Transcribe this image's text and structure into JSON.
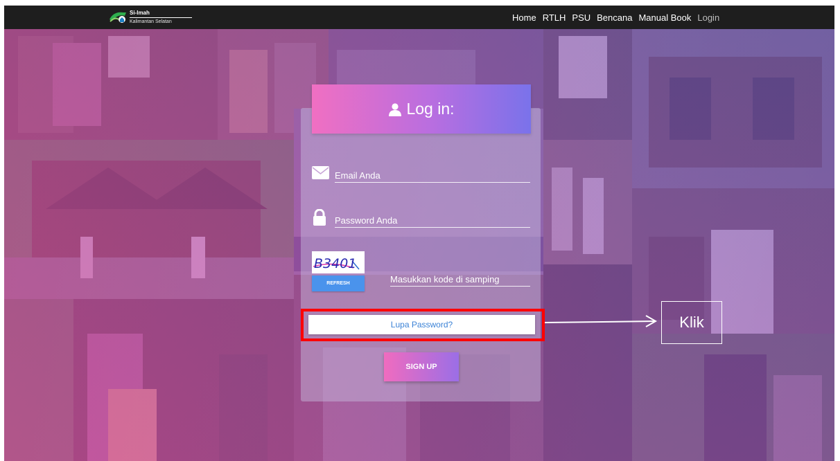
{
  "brand": {
    "name": "Si-Imah",
    "subtitle": "Kalimantan Selatan"
  },
  "nav": [
    {
      "label": "Home",
      "active": false
    },
    {
      "label": "RTLH",
      "active": false
    },
    {
      "label": "PSU",
      "active": false
    },
    {
      "label": "Bencana",
      "active": false
    },
    {
      "label": "Manual Book",
      "active": false
    },
    {
      "label": "Login",
      "active": true
    }
  ],
  "login": {
    "title": "Log in:",
    "email_placeholder": "Email Anda",
    "password_placeholder": "Password Anda",
    "captcha_text": "B3401",
    "refresh_label": "REFRESH",
    "captcha_placeholder": "Masukkan kode di samping",
    "forgot_label": "Lupa Password?",
    "signup_label": "SIGN UP"
  },
  "annotation": {
    "label": "Klik",
    "highlight_color": "#ff0000"
  },
  "colors": {
    "navbar": "#1e1e1e",
    "refresh": "#4a93ec",
    "link": "#3b82d6"
  }
}
